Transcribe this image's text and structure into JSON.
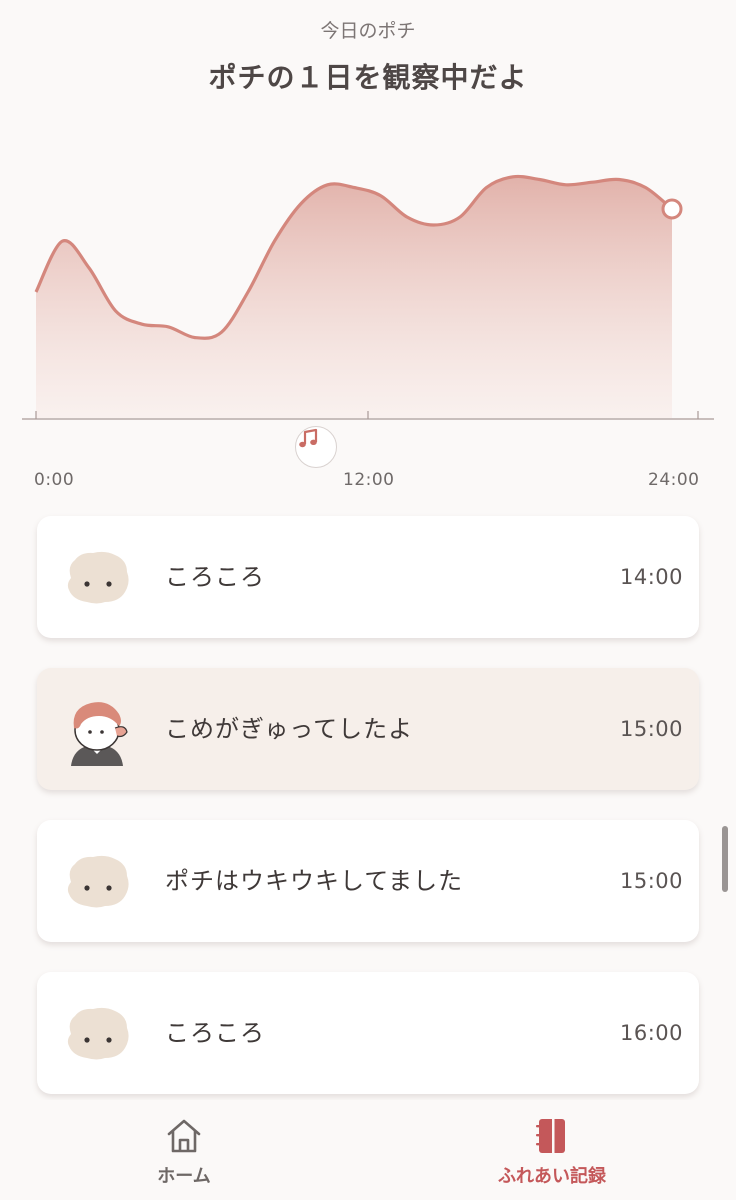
{
  "header": {
    "subtitle": "今日のポチ",
    "title": "ポチの１日を観察中だよ"
  },
  "colors": {
    "accent": "#d4877d",
    "accent_dark": "#c4585a",
    "background": "#fbf9f8",
    "highlight_card": "#f6efea"
  },
  "chart_data": {
    "type": "area",
    "x": [
      0,
      1,
      2,
      3,
      4,
      5,
      6,
      7,
      8,
      9,
      10,
      11,
      12,
      13,
      14,
      15,
      16,
      17,
      18,
      19,
      20,
      21,
      22,
      23,
      24
    ],
    "values": [
      47,
      66,
      56,
      40,
      35,
      34,
      30,
      32,
      47,
      66,
      80,
      87,
      86,
      83,
      75,
      72,
      75,
      86,
      90,
      89,
      87,
      88,
      89,
      86,
      78
    ],
    "xlim": [
      0,
      24
    ],
    "ylim": [
      0,
      100
    ],
    "x_ticks": [
      "0:00",
      "12:00",
      "24:00"
    ],
    "marker_icon": "music-note-icon",
    "marker_hour": 10.5
  },
  "events": [
    {
      "avatar": "fluffy-creature-icon",
      "text": "ころころ",
      "time": "14:00",
      "highlight": false
    },
    {
      "avatar": "boy-avatar-icon",
      "text": "こめがぎゅってしたよ",
      "time": "15:00",
      "highlight": true
    },
    {
      "avatar": "fluffy-creature-icon",
      "text": "ポチはウキウキしてました",
      "time": "15:00",
      "highlight": false
    },
    {
      "avatar": "fluffy-creature-icon",
      "text": "ころころ",
      "time": "16:00",
      "highlight": false
    }
  ],
  "nav": {
    "home_label": "ホーム",
    "home_icon": "home-icon",
    "records_label": "ふれあい記録",
    "records_icon": "notebook-icon",
    "active": "records"
  }
}
